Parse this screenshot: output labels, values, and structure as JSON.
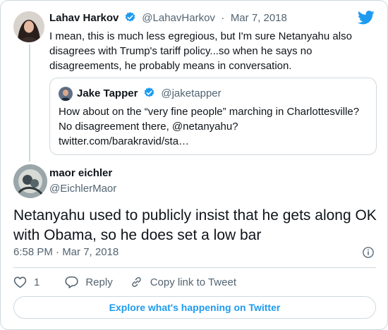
{
  "colors": {
    "accent": "#1d9bf0",
    "muted": "#536471",
    "border": "#cfd9de",
    "text": "#0f1419"
  },
  "reply_tweet": {
    "author_name": "Lahav Harkov",
    "handle": "@LahavHarkov",
    "separator": "·",
    "date": "Mar 7, 2018",
    "text": "I mean, this is much less egregious, but I'm sure Netanyahu also disagrees with Trump's tariff policy...so when he says no disagreements, he probably means in conversation.",
    "quoted_tweet": {
      "author_name": "Jake Tapper",
      "handle": "@jaketapper",
      "text_line1": "How about on the “very fine people” marching in Charlottesville?",
      "text_line2": "No disagreement there, @netanyahu?",
      "text_line3": "twitter.com/barakravid/sta…"
    }
  },
  "main_tweet": {
    "author_name": "maor eichler",
    "handle": "@EichlerMaor",
    "text": "Netanyahu used to publicly insist that he gets along OK with Obama, so he does set a low bar",
    "timestamp": "6:58 PM · Mar 7, 2018"
  },
  "actions": {
    "like_count": "1",
    "reply_label": "Reply",
    "copy_label": "Copy link to Tweet"
  },
  "explore_label": "Explore what's happening on Twitter",
  "icons": [
    "twitter-bird-icon",
    "verified-badge-icon",
    "info-icon",
    "heart-icon",
    "reply-icon",
    "link-icon"
  ]
}
